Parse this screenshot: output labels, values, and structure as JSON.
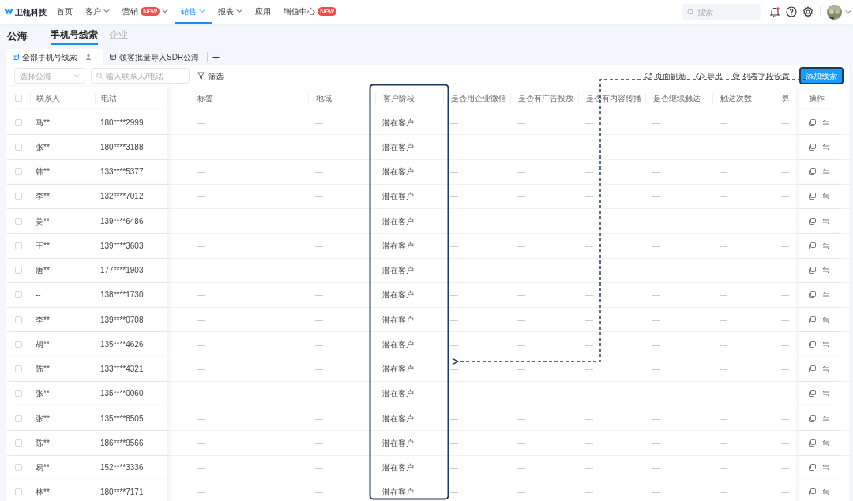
{
  "nav": {
    "logo": "卫瓴科技",
    "items": [
      {
        "label": "首页",
        "selected": false,
        "dropdown": false
      },
      {
        "label": "客户",
        "selected": false,
        "dropdown": true
      },
      {
        "label": "营销",
        "selected": false,
        "dropdown": true,
        "badge": "New"
      },
      {
        "label": "销售",
        "selected": true,
        "dropdown": true
      },
      {
        "label": "报表",
        "selected": false,
        "dropdown": true
      },
      {
        "label": "应用",
        "selected": false,
        "dropdown": false
      },
      {
        "label": "增值中心",
        "selected": false,
        "dropdown": false,
        "badge": "New"
      }
    ],
    "search": {
      "placeholder": "搜索"
    },
    "notifications_unread": true
  },
  "page": {
    "title": "公海",
    "tabs": [
      {
        "label": "手机号线索",
        "selected": true
      },
      {
        "label": "企业",
        "selected": false
      }
    ]
  },
  "views": [
    {
      "label": "全部手机号线索",
      "selected": true
    },
    {
      "label": "领客批量导入SDR公海",
      "selected": false
    }
  ],
  "toolbar": {
    "pool_select": {
      "placeholder": "选择公海"
    },
    "search": {
      "placeholder": "输入联系人/电话"
    },
    "filter": "筛选",
    "actions": [
      "页面刷新",
      "导出",
      "列表字段设置"
    ],
    "primary": "添加线索"
  },
  "table": {
    "header_checked": false,
    "columns": [
      "联系人",
      "电话",
      "标签",
      "地域",
      "客户阶段",
      "是否用企业微信",
      "是否有广告投放",
      "是否有内容传播",
      "是否继续触达",
      "触达次数",
      "算"
    ],
    "action_column": "操作",
    "rows": [
      {
        "checked": false,
        "cells": [
          "马**",
          "180****2999",
          "—",
          "—",
          "潜在客户",
          "—",
          "—",
          "—",
          "—",
          "—",
          "—"
        ]
      },
      {
        "checked": false,
        "cells": [
          "张**",
          "180****3188",
          "—",
          "—",
          "潜在客户",
          "—",
          "—",
          "—",
          "—",
          "—",
          "—"
        ]
      },
      {
        "checked": false,
        "cells": [
          "韩**",
          "133****5377",
          "—",
          "—",
          "潜在客户",
          "—",
          "—",
          "—",
          "—",
          "—",
          "—"
        ]
      },
      {
        "checked": false,
        "cells": [
          "李**",
          "132****7012",
          "—",
          "—",
          "潜在客户",
          "—",
          "—",
          "—",
          "—",
          "—",
          "—"
        ]
      },
      {
        "checked": false,
        "cells": [
          "姜**",
          "139****6486",
          "—",
          "—",
          "潜在客户",
          "—",
          "—",
          "—",
          "—",
          "—",
          "—"
        ]
      },
      {
        "checked": false,
        "cells": [
          "王**",
          "139****3603",
          "—",
          "—",
          "潜在客户",
          "—",
          "—",
          "—",
          "—",
          "—",
          "—"
        ]
      },
      {
        "checked": false,
        "cells": [
          "唐**",
          "177****1903",
          "—",
          "—",
          "潜在客户",
          "—",
          "—",
          "—",
          "—",
          "—",
          "—"
        ]
      },
      {
        "checked": false,
        "cells": [
          "--",
          "138****1730",
          "—",
          "—",
          "潜在客户",
          "—",
          "—",
          "—",
          "—",
          "—",
          "—"
        ]
      },
      {
        "checked": false,
        "cells": [
          "李**",
          "139****0708",
          "—",
          "—",
          "潜在客户",
          "—",
          "—",
          "—",
          "—",
          "—",
          "—"
        ]
      },
      {
        "checked": false,
        "cells": [
          "胡**",
          "135****4626",
          "—",
          "—",
          "潜在客户",
          "—",
          "—",
          "—",
          "—",
          "—",
          "—"
        ]
      },
      {
        "checked": false,
        "cells": [
          "陈**",
          "133****4321",
          "—",
          "—",
          "潜在客户",
          "—",
          "—",
          "—",
          "—",
          "—",
          "—"
        ]
      },
      {
        "checked": false,
        "cells": [
          "张**",
          "135****0060",
          "—",
          "—",
          "潜在客户",
          "—",
          "—",
          "—",
          "—",
          "—",
          "—"
        ]
      },
      {
        "checked": false,
        "cells": [
          "张**",
          "135****8505",
          "—",
          "—",
          "潜在客户",
          "—",
          "—",
          "—",
          "—",
          "—",
          "—"
        ]
      },
      {
        "checked": false,
        "cells": [
          "陈**",
          "186****9566",
          "—",
          "—",
          "潜在客户",
          "—",
          "—",
          "—",
          "—",
          "—",
          "—"
        ]
      },
      {
        "checked": false,
        "cells": [
          "易**",
          "152****3336",
          "—",
          "—",
          "潜在客户",
          "—",
          "—",
          "—",
          "—",
          "—",
          "—"
        ]
      },
      {
        "checked": false,
        "cells": [
          "林**",
          "180****7171",
          "—",
          "—",
          "潜在客户",
          "—",
          "—",
          "—",
          "—",
          "—",
          "—"
        ]
      }
    ]
  }
}
